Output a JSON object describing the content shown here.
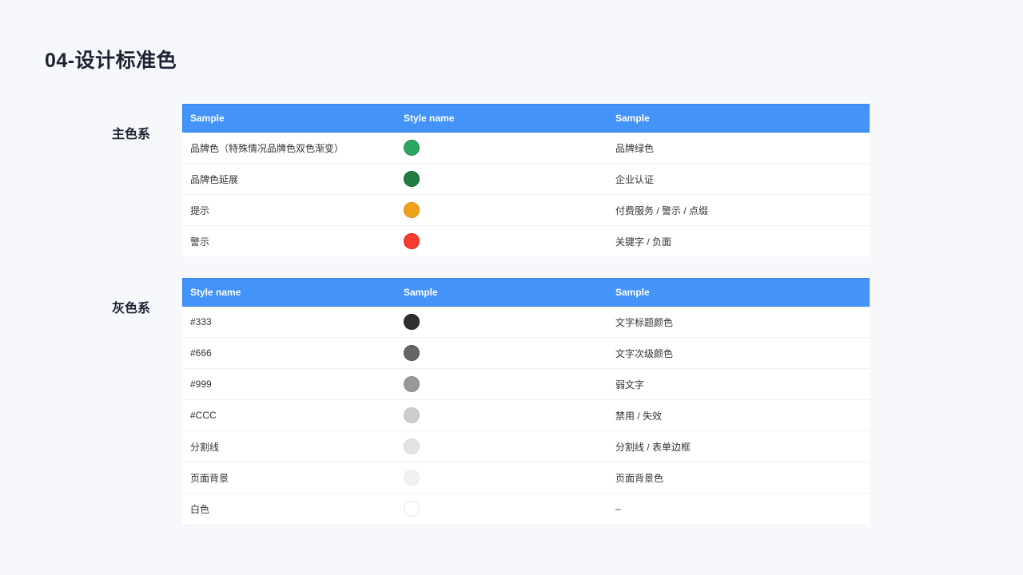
{
  "page": {
    "title": "04-设计标准色",
    "background_color": "#F6F8FB",
    "header_color": "#4493F8"
  },
  "sections": [
    {
      "label": "主色系",
      "headers": [
        "Sample",
        "Style name",
        "Sample"
      ],
      "rows": [
        {
          "name": "品牌色（特殊情况品牌色双色渐变）",
          "swatch_color": "#2BA760",
          "swatch_border": "#1F8E4D",
          "usage": "品牌绿色"
        },
        {
          "name": "品牌色延展",
          "swatch_color": "#1F7E3F",
          "swatch_border": "#176632",
          "usage": "企业认证"
        },
        {
          "name": "提示",
          "swatch_color": "#EFA11C",
          "swatch_border": "#D88E0F",
          "usage": "付费服务 / 警示 / 点缀"
        },
        {
          "name": "警示",
          "swatch_color": "#F63B30",
          "swatch_border": "#DD2318",
          "usage": "关键字 /  负面"
        }
      ]
    },
    {
      "label": "灰色系",
      "headers": [
        "Style name",
        "Sample",
        "Sample"
      ],
      "rows": [
        {
          "name": "#333",
          "swatch_color": "#2F2F2F",
          "swatch_border": "#1A1A1A",
          "usage": "文字标题颜色"
        },
        {
          "name": "#666",
          "swatch_color": "#666666",
          "swatch_border": "#515151",
          "usage": "文字次级颜色"
        },
        {
          "name": "#999",
          "swatch_color": "#999999",
          "swatch_border": "#898989",
          "usage": "弱文字"
        },
        {
          "name": "#CCC",
          "swatch_color": "#CCCCCC",
          "swatch_border": "#BFBFBF",
          "usage": "禁用 / 失效"
        },
        {
          "name": "分割线",
          "swatch_color": "#E3E3E3",
          "swatch_border": "#D9D9D9",
          "usage": "分割线 / 表单边框"
        },
        {
          "name": "页面背景",
          "swatch_color": "#F0F0F0",
          "swatch_border": "#E9E9E9",
          "usage": "页面背景色"
        },
        {
          "name": "白色",
          "swatch_color": "#FFFFFF",
          "swatch_border": "#E6E6E6",
          "usage": "–"
        }
      ]
    }
  ]
}
